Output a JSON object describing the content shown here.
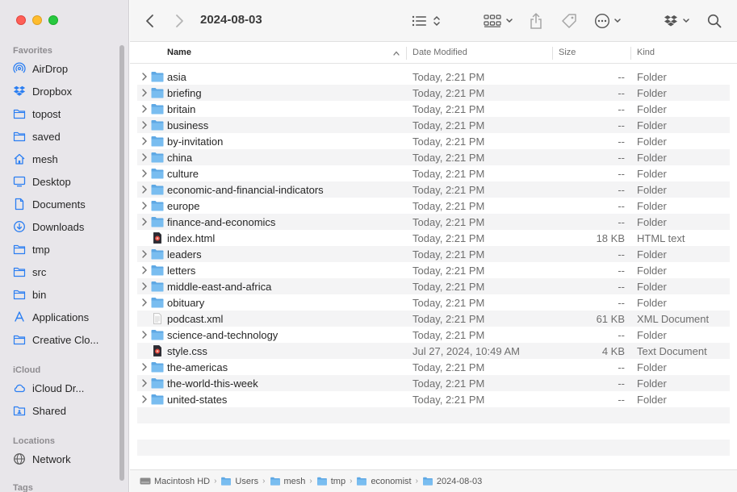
{
  "window": {
    "title": "2024-08-03"
  },
  "sidebar": {
    "sections": [
      {
        "label": "Favorites"
      },
      {
        "label": "iCloud"
      },
      {
        "label": "Locations"
      },
      {
        "label": "Tags"
      }
    ],
    "favorites": [
      {
        "label": "AirDrop",
        "icon": "airdrop-icon"
      },
      {
        "label": "Dropbox",
        "icon": "dropbox-icon"
      },
      {
        "label": "topost",
        "icon": "folder-icon"
      },
      {
        "label": "saved",
        "icon": "folder-icon"
      },
      {
        "label": "mesh",
        "icon": "home-icon"
      },
      {
        "label": "Desktop",
        "icon": "desktop-icon"
      },
      {
        "label": "Documents",
        "icon": "document-icon"
      },
      {
        "label": "Downloads",
        "icon": "downloads-icon"
      },
      {
        "label": "tmp",
        "icon": "folder-icon"
      },
      {
        "label": "src",
        "icon": "folder-icon"
      },
      {
        "label": "bin",
        "icon": "folder-icon"
      },
      {
        "label": "Applications",
        "icon": "applications-icon"
      },
      {
        "label": "Creative Clo...",
        "icon": "folder-icon"
      }
    ],
    "icloud": [
      {
        "label": "iCloud Dr...",
        "icon": "cloud-icon"
      },
      {
        "label": "Shared",
        "icon": "shared-folder-icon"
      }
    ],
    "locations": [
      {
        "label": "Network",
        "icon": "network-icon"
      }
    ]
  },
  "columns": {
    "name": "Name",
    "date": "Date Modified",
    "size": "Size",
    "kind": "Kind"
  },
  "files": [
    {
      "name": "asia",
      "date": "Today, 2:21 PM",
      "size": "--",
      "kind": "Folder",
      "type": "folder"
    },
    {
      "name": "briefing",
      "date": "Today, 2:21 PM",
      "size": "--",
      "kind": "Folder",
      "type": "folder"
    },
    {
      "name": "britain",
      "date": "Today, 2:21 PM",
      "size": "--",
      "kind": "Folder",
      "type": "folder"
    },
    {
      "name": "business",
      "date": "Today, 2:21 PM",
      "size": "--",
      "kind": "Folder",
      "type": "folder"
    },
    {
      "name": "by-invitation",
      "date": "Today, 2:21 PM",
      "size": "--",
      "kind": "Folder",
      "type": "folder"
    },
    {
      "name": "china",
      "date": "Today, 2:21 PM",
      "size": "--",
      "kind": "Folder",
      "type": "folder"
    },
    {
      "name": "culture",
      "date": "Today, 2:21 PM",
      "size": "--",
      "kind": "Folder",
      "type": "folder"
    },
    {
      "name": "economic-and-financial-indicators",
      "date": "Today, 2:21 PM",
      "size": "--",
      "kind": "Folder",
      "type": "folder"
    },
    {
      "name": "europe",
      "date": "Today, 2:21 PM",
      "size": "--",
      "kind": "Folder",
      "type": "folder"
    },
    {
      "name": "finance-and-economics",
      "date": "Today, 2:21 PM",
      "size": "--",
      "kind": "Folder",
      "type": "folder"
    },
    {
      "name": "index.html",
      "date": "Today, 2:21 PM",
      "size": "18 KB",
      "kind": "HTML text",
      "type": "html"
    },
    {
      "name": "leaders",
      "date": "Today, 2:21 PM",
      "size": "--",
      "kind": "Folder",
      "type": "folder"
    },
    {
      "name": "letters",
      "date": "Today, 2:21 PM",
      "size": "--",
      "kind": "Folder",
      "type": "folder"
    },
    {
      "name": "middle-east-and-africa",
      "date": "Today, 2:21 PM",
      "size": "--",
      "kind": "Folder",
      "type": "folder"
    },
    {
      "name": "obituary",
      "date": "Today, 2:21 PM",
      "size": "--",
      "kind": "Folder",
      "type": "folder"
    },
    {
      "name": "podcast.xml",
      "date": "Today, 2:21 PM",
      "size": "61 KB",
      "kind": "XML Document",
      "type": "xml"
    },
    {
      "name": "science-and-technology",
      "date": "Today, 2:21 PM",
      "size": "--",
      "kind": "Folder",
      "type": "folder"
    },
    {
      "name": "style.css",
      "date": "Jul 27, 2024, 10:49 AM",
      "size": "4 KB",
      "kind": "Text Document",
      "type": "css"
    },
    {
      "name": "the-americas",
      "date": "Today, 2:21 PM",
      "size": "--",
      "kind": "Folder",
      "type": "folder"
    },
    {
      "name": "the-world-this-week",
      "date": "Today, 2:21 PM",
      "size": "--",
      "kind": "Folder",
      "type": "folder"
    },
    {
      "name": "united-states",
      "date": "Today, 2:21 PM",
      "size": "--",
      "kind": "Folder",
      "type": "folder"
    }
  ],
  "pathbar": [
    {
      "label": "Macintosh HD",
      "icon": "hard-drive-icon"
    },
    {
      "label": "Users",
      "icon": "folder-icon"
    },
    {
      "label": "mesh",
      "icon": "folder-icon"
    },
    {
      "label": "tmp",
      "icon": "folder-icon"
    },
    {
      "label": "economist",
      "icon": "folder-icon"
    },
    {
      "label": "2024-08-03",
      "icon": "folder-icon"
    }
  ],
  "colors": {
    "accent": "#2a7ef2",
    "folder": "#6bb6ec",
    "sidebar_bg": "#e8e6ea"
  }
}
